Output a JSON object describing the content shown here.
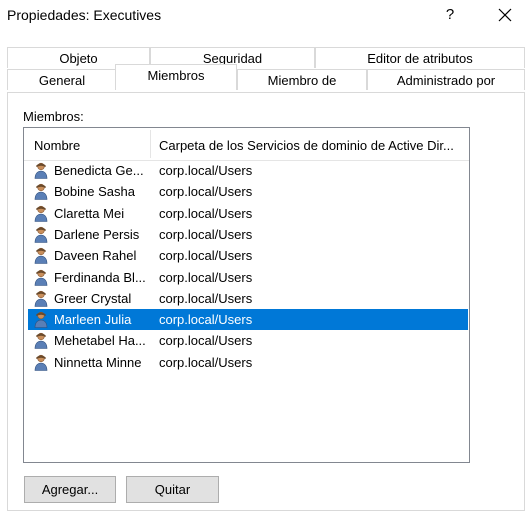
{
  "window": {
    "title": "Propiedades: Executives",
    "help_glyph": "?"
  },
  "tabs": {
    "row_back": [
      "Objeto",
      "Seguridad",
      "Editor de atributos"
    ],
    "row_front": [
      "General",
      "Miembros",
      "Miembro de",
      "Administrado por"
    ],
    "selected": "Miembros"
  },
  "members": {
    "label": "Miembros:",
    "columns": [
      "Nombre",
      "Carpeta de los Servicios de dominio de Active Dir..."
    ],
    "rows": [
      {
        "name": "Benedicta Ge...",
        "folder": "corp.local/Users",
        "icon": "user-icon"
      },
      {
        "name": "Bobine Sasha",
        "folder": "corp.local/Users",
        "icon": "user-icon"
      },
      {
        "name": "Claretta Mei",
        "folder": "corp.local/Users",
        "icon": "user-icon"
      },
      {
        "name": "Darlene Persis",
        "folder": "corp.local/Users",
        "icon": "user-icon"
      },
      {
        "name": "Daveen Rahel",
        "folder": "corp.local/Users",
        "icon": "user-icon"
      },
      {
        "name": "Ferdinanda Bl...",
        "folder": "corp.local/Users",
        "icon": "user-icon"
      },
      {
        "name": "Greer Crystal",
        "folder": "corp.local/Users",
        "icon": "user-icon"
      },
      {
        "name": "Marleen Julia",
        "folder": "corp.local/Users",
        "icon": "user-icon",
        "selected": true
      },
      {
        "name": "Mehetabel Ha...",
        "folder": "corp.local/Users",
        "icon": "user-icon"
      },
      {
        "name": "Ninnetta Minne",
        "folder": "corp.local/Users",
        "icon": "user-icon"
      }
    ]
  },
  "buttons": {
    "add": "Agregar...",
    "remove": "Quitar"
  },
  "colors": {
    "selection": "#0078d7",
    "border": "#828790",
    "button_bg": "#e1e1e1"
  }
}
